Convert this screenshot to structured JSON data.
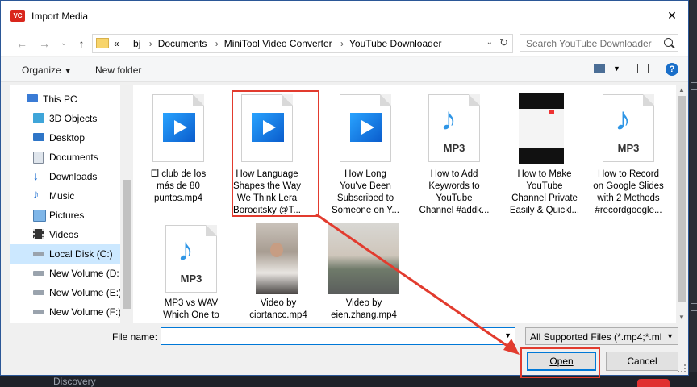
{
  "dialog": {
    "title": "Import Media",
    "logo_text": "VC",
    "close_glyph": "✕"
  },
  "nav": {
    "back_glyph": "←",
    "forward_glyph": "→",
    "recent_glyph": "⌄",
    "up_glyph": "↑",
    "crumb_prefix": "«",
    "breadcrumbs": [
      "bj",
      "Documents",
      "MiniTool Video Converter",
      "YouTube Downloader"
    ],
    "search_placeholder": "Search YouTube Downloader"
  },
  "toolbar": {
    "organize": "Organize",
    "new_folder": "New folder",
    "help": "?"
  },
  "sidebar": {
    "items": [
      {
        "label": "This PC",
        "icon": "computer-icon"
      },
      {
        "label": "3D Objects",
        "icon": "cube-icon"
      },
      {
        "label": "Desktop",
        "icon": "desktop-icon"
      },
      {
        "label": "Documents",
        "icon": "document-icon"
      },
      {
        "label": "Downloads",
        "icon": "download-arrow-icon"
      },
      {
        "label": "Music",
        "icon": "music-note-icon"
      },
      {
        "label": "Pictures",
        "icon": "picture-icon"
      },
      {
        "label": "Videos",
        "icon": "film-icon"
      },
      {
        "label": "Local Disk (C:)",
        "icon": "drive-icon"
      },
      {
        "label": "New Volume (D:",
        "icon": "drive-icon"
      },
      {
        "label": "New Volume (E:)",
        "icon": "drive-icon"
      },
      {
        "label": "New Volume (F:)",
        "icon": "drive-icon"
      }
    ]
  },
  "files": [
    {
      "line1": "El club de los",
      "line2": "más de 80",
      "line3": "puntos.mp4",
      "line4": "",
      "type": "video"
    },
    {
      "line1": "How Language",
      "line2": "Shapes the Way",
      "line3": "We Think  Lera",
      "line4": "Boroditsky @T...",
      "type": "video"
    },
    {
      "line1": "How Long",
      "line2": "You've Been",
      "line3": "Subscribed to",
      "line4": "Someone on Y...",
      "type": "video"
    },
    {
      "line1": "How to Add",
      "line2": "Keywords to",
      "line3": "YouTube",
      "line4": "Channel #addk...",
      "type": "mp3"
    },
    {
      "line1": "How to Make",
      "line2": "YouTube",
      "line3": "Channel Private",
      "line4": "Easily & Quickl...",
      "type": "thumb"
    },
    {
      "line1": "How to Record",
      "line2": "on Google Slides",
      "line3": "with 2 Methods",
      "line4": "#recordgoogle...",
      "type": "mp3"
    },
    {
      "line1": "MP3 vs WAV",
      "line2": "Which One to",
      "type": "mp3"
    },
    {
      "line1": "Video by",
      "line2": "ciortancc.mp4",
      "type": "photo"
    },
    {
      "line1": "Video by",
      "line2": "eien.zhang.mp4",
      "type": "landscape"
    }
  ],
  "mp3_label": "MP3",
  "mp3_note": "♪",
  "footer": {
    "file_name_label": "File name:",
    "file_name_value": "",
    "file_type": "All Supported Files (*.mp4;*.mk",
    "open": "Open",
    "cancel": "Cancel"
  },
  "background_app": {
    "discovery": "Discovery"
  },
  "colors": {
    "accent": "#0078d7",
    "highlight": "#e23b2e",
    "selected_bg": "#cce8ff"
  }
}
